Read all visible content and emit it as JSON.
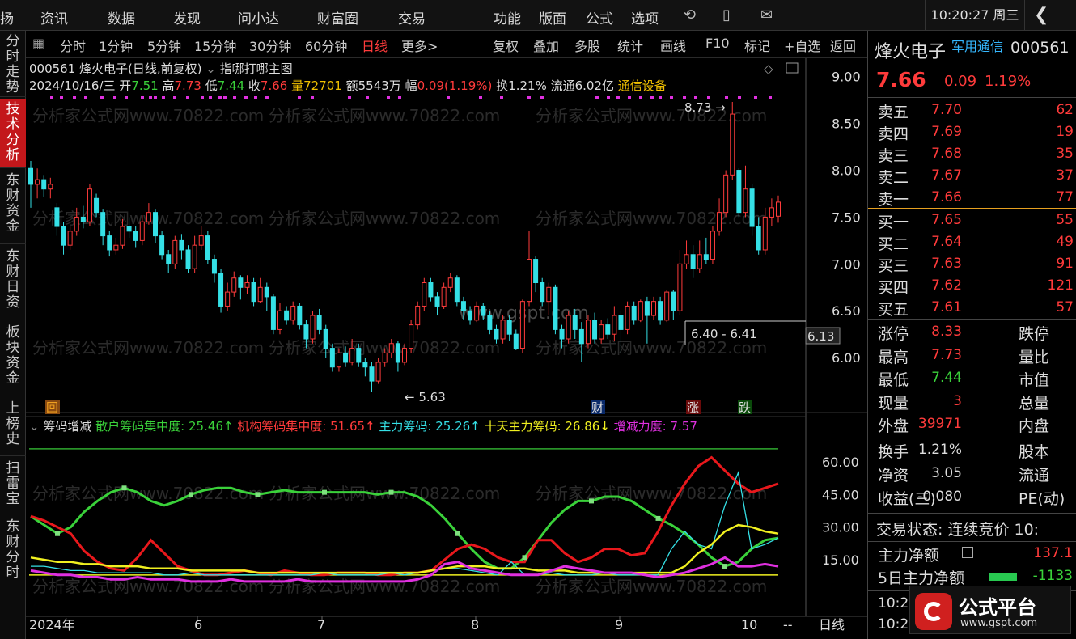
{
  "topbar": {
    "menu": [
      "扬",
      "资讯",
      "数据",
      "发现",
      "问小达",
      "财富圈",
      "交易",
      "功能",
      "版面",
      "公式",
      "选项"
    ],
    "clock": "10:20:27 周三"
  },
  "leftnav": [
    "分时走势",
    "技术分析",
    "东财资金",
    "东财日资",
    "板块资金",
    "上榜史",
    "扫雷宝",
    "东财分时"
  ],
  "toolbar": {
    "periods": [
      "分时",
      "1分钟",
      "5分钟",
      "15分钟",
      "30分钟",
      "60分钟",
      "日线",
      "更多>"
    ],
    "actions": [
      "复权",
      "叠加",
      "多股",
      "统计",
      "画线",
      "F10",
      "标记",
      "+自选",
      "返回"
    ]
  },
  "kline": {
    "title": "000561  烽火电子(日线,前复权)",
    "formula": "指哪打哪主图",
    "date": "2024/10/16/三",
    "open_label": "开",
    "open": "7.51",
    "high_label": "高",
    "high": "7.73",
    "low_label": "低",
    "low": "7.44",
    "close_label": "收",
    "close": "7.66",
    "vol_label": "量",
    "vol": "72701",
    "amt_label": "额",
    "amt": "5543万",
    "chg_label": "幅",
    "chg": "0.09(1.19%)",
    "turnover": "换1.21%",
    "float": "流通6.02亿",
    "sector": "通信设备",
    "annot_high": "8.73",
    "annot_low": "5.63",
    "annot_range": "6.40 - 6.41",
    "cursor_price": "6.13",
    "yticks": [
      "9.00",
      "8.50",
      "8.00",
      "7.50",
      "7.00",
      "6.50",
      "6.00"
    ],
    "markers": [
      "回",
      "财",
      "涨",
      "跌"
    ],
    "watermark": "分析家公式网www.70822.com",
    "watermark2": "www.gspt.com"
  },
  "indicator": {
    "name": "筹码增减",
    "s1_label": "散户筹码集中度: 25.46↑",
    "s2_label": "机构筹码集中度: 51.65↑",
    "s3_label": "主力筹码: 25.26↑",
    "s4_label": "十天主力筹码: 26.86↓",
    "s5_label": "增减力度: 7.57",
    "yticks": [
      "60.00",
      "45.00",
      "30.00",
      "15.00"
    ]
  },
  "xaxis": [
    "2024年",
    "6",
    "7",
    "8",
    "9",
    "10",
    "--",
    "日线"
  ],
  "colors": {
    "up": "#ff3b3b",
    "down": "#35e0e6",
    "green": "#3ad13a",
    "yellow": "#f0f020",
    "magenta": "#e030e0"
  },
  "quote": {
    "name": "烽火电子",
    "tag": "军用通信",
    "code": "000561",
    "price": "7.66",
    "chg": "0.09",
    "pct": "1.19%",
    "asks": [
      [
        "卖五",
        "7.70",
        "62"
      ],
      [
        "卖四",
        "7.69",
        "19"
      ],
      [
        "卖三",
        "7.68",
        "35"
      ],
      [
        "卖二",
        "7.67",
        "37"
      ],
      [
        "卖一",
        "7.66",
        "77"
      ]
    ],
    "bids": [
      [
        "买一",
        "7.65",
        "55"
      ],
      [
        "买二",
        "7.64",
        "49"
      ],
      [
        "买三",
        "7.63",
        "91"
      ],
      [
        "买四",
        "7.62",
        "121"
      ],
      [
        "买五",
        "7.61",
        "57"
      ]
    ],
    "stats": [
      [
        "涨停",
        "8.33",
        "跌停"
      ],
      [
        "最高",
        "7.73",
        "量比"
      ],
      [
        "最低",
        "7.44",
        "市值"
      ],
      [
        "现量",
        "3",
        "总量"
      ],
      [
        "外盘",
        "39971",
        "内盘"
      ]
    ],
    "stats2": [
      [
        "换手",
        "1.21%",
        "股本"
      ],
      [
        "净资",
        "3.05",
        "流通"
      ],
      [
        "收益(三)",
        "-0.080",
        "PE(动)"
      ]
    ],
    "status": "交易状态: 连续竞价  10:",
    "main_net_label": "主力净额",
    "main_net": "137.1",
    "net5_label": "5日主力净额",
    "net5": "-1133",
    "time1": "10:2",
    "time2": "10:2"
  },
  "logo": {
    "text": "公式平台",
    "url": "www.gspt.com"
  }
}
